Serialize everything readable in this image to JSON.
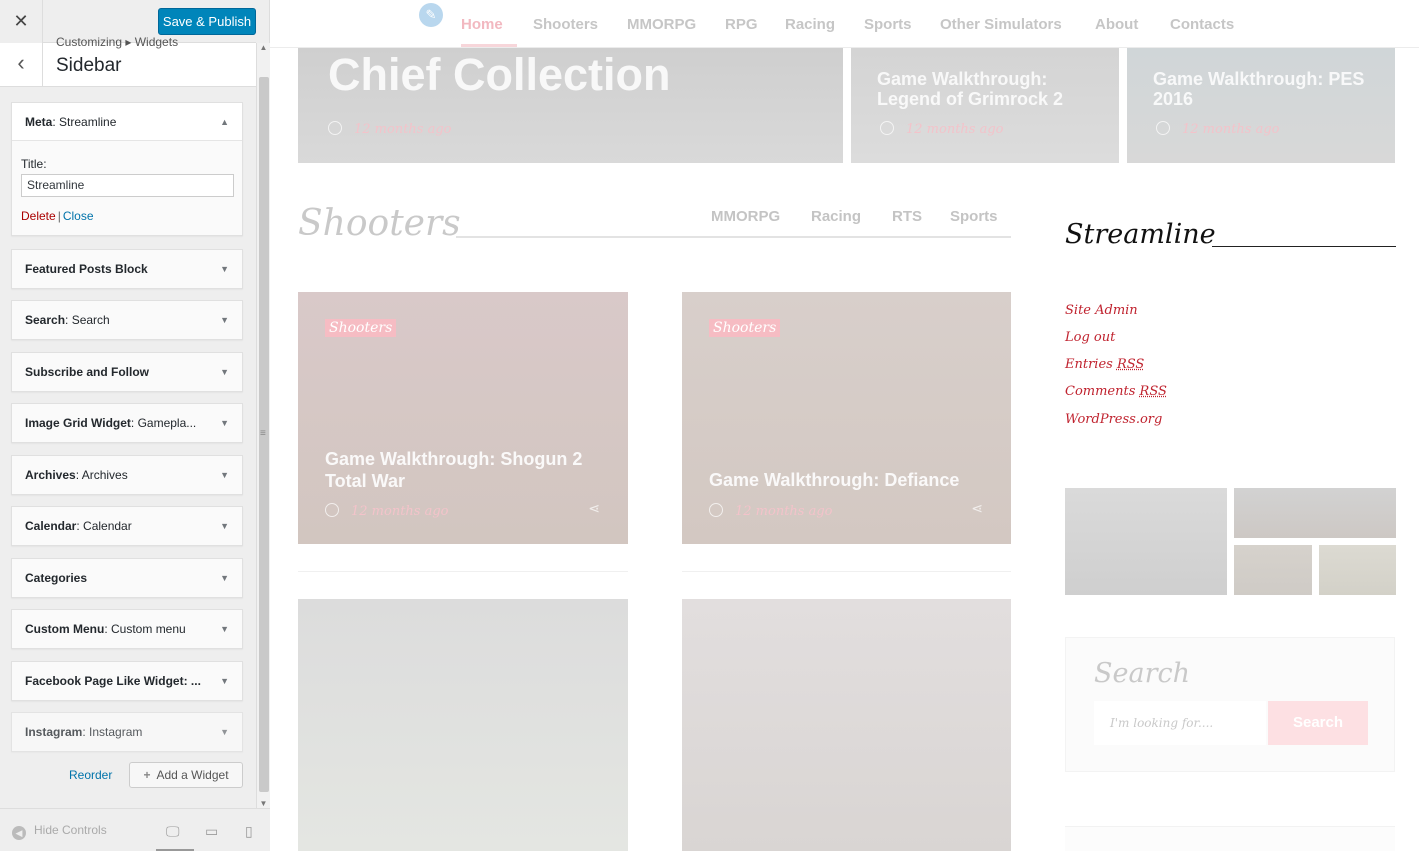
{
  "customizer": {
    "close_icon": "close-icon",
    "save_label": "Save & Publish",
    "breadcrumb": "Customizing ▸ Widgets",
    "section_title": "Sidebar",
    "widgets": [
      {
        "name": "Meta",
        "subtitle": ": Streamline",
        "expanded": true
      },
      {
        "name": "Featured Posts Block",
        "subtitle": ""
      },
      {
        "name": "Search",
        "subtitle": ": Search"
      },
      {
        "name": "Subscribe and Follow",
        "subtitle": ""
      },
      {
        "name": "Image Grid Widget",
        "subtitle": ": Gamepla..."
      },
      {
        "name": "Archives",
        "subtitle": ": Archives"
      },
      {
        "name": "Calendar",
        "subtitle": ": Calendar"
      },
      {
        "name": "Categories",
        "subtitle": ""
      },
      {
        "name": "Custom Menu",
        "subtitle": ": Custom menu"
      },
      {
        "name": "Facebook Page Like Widget: ...",
        "subtitle": ""
      },
      {
        "name": "Instagram",
        "subtitle": ": Instagram"
      }
    ],
    "meta_form": {
      "title_label": "Title:",
      "title_value": "Streamline",
      "delete_label": "Delete",
      "separator": "|",
      "close_label": "Close"
    },
    "reorder_label": "Reorder",
    "add_widget_label": "Add a Widget",
    "hide_controls_label": "Hide Controls",
    "accent_color": "#0085ba"
  },
  "site": {
    "nav": [
      "Home",
      "Shooters",
      "MMORPG",
      "RPG",
      "Racing",
      "Sports",
      "Other Simulators",
      "About",
      "Contacts"
    ],
    "featured": [
      {
        "title": "Chief Collection",
        "meta": "12 months ago"
      },
      {
        "title": "Game Walkthrough: Legend of Grimrock 2",
        "meta": "12 months ago"
      },
      {
        "title": "Game Walkthrough: PES 2016",
        "meta": "12 months ago"
      }
    ],
    "section": {
      "title": "Shooters",
      "tabs": [
        "MMORPG",
        "Racing",
        "RTS",
        "Sports"
      ]
    },
    "cards": [
      {
        "badge": "Shooters",
        "title": "Game Walkthrough: Shogun 2 Total War",
        "meta": "12 months ago"
      },
      {
        "badge": "Shooters",
        "title": "Game Walkthrough: Defiance",
        "meta": "12 months ago"
      }
    ],
    "sidebar": {
      "title": "Streamline",
      "links": [
        "Site Admin",
        "Log out",
        "Entries",
        "Comments",
        "WordPress.org"
      ],
      "rss": "RSS",
      "search_title": "Search",
      "search_placeholder": "I'm looking for....",
      "search_button": "Search"
    },
    "accent_color": "#c0232f"
  }
}
